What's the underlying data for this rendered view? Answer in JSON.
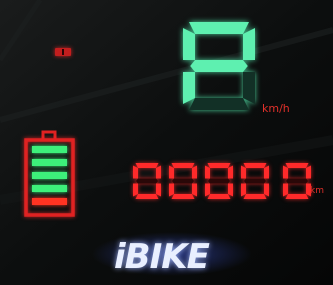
{
  "colors": {
    "speed_active": "#5ef0b0",
    "speed_dim": "#123026",
    "odo_active": "#ff2a2a",
    "odo_dim": "#2a0808",
    "unit_text": "#e0302a",
    "battery_frame": "#e02222",
    "battery_full": "#3df07a",
    "battery_low": "#ff3322",
    "logo": "#e9efff",
    "logo_glow": "#6f88ff"
  },
  "indicator": {
    "icon": "warning-light-icon"
  },
  "speed": {
    "value": "P",
    "unit": "km/h"
  },
  "battery": {
    "segments_on": 4,
    "segments_total": 5,
    "low_segment_index": 3
  },
  "odometer": {
    "value": "00000",
    "unit": "km"
  },
  "brand": {
    "name": "iBIKE"
  }
}
